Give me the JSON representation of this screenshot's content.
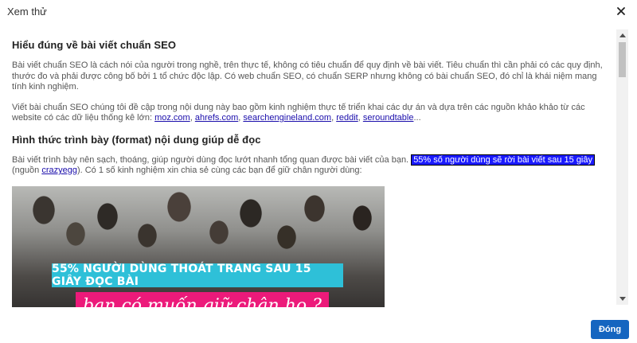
{
  "dialog": {
    "title": "Xem thử",
    "close_label": "×",
    "done_label": "Đóng"
  },
  "article": {
    "heading1": "Hiểu đúng về bài viết chuẩn SEO",
    "p1": "Bài viết chuẩn SEO là cách nói của người trong nghề, trên thực tế, không có tiêu chuẩn để quy định về bài viết. Tiêu chuẩn thì cần phải có các quy định, thước đo và phải được công bố bởi 1 tổ chức độc lập. Có web chuẩn SEO, có chuẩn SERP nhưng không có bài chuẩn SEO, đó chỉ là khái niệm mang tính kinh nghiệm.",
    "p2_text": "Viết bài chuẩn SEO chúng tôi đề cập trong nội dung này bao gồm kinh nghiệm thực tế triển khai các dự án và dựa trên các nguồn khảo khảo từ các website có các dữ liệu thống kê lớn:",
    "p2_links": [
      "moz.com",
      "ahrefs.com",
      "searchengineland.com",
      "reddit",
      "seroundtable"
    ],
    "p2_sep": ", ",
    "p2_end": "...",
    "heading2": "Hình thức trình bày (format) nội dung giúp dễ đọc",
    "p3_before": "Bài viết trình bày nên sạch, thoáng, giúp người dùng đọc lướt nhanh tổng quan được bài viết của bạn.",
    "p3_highlight": "55% số người dùng sẽ rời bài viết sau 15 giây",
    "p3_mid": " (nguồn ",
    "p3_link": "crazyegg",
    "p3_after": "). Có 1 số kinh nghiệm xin chia sẻ cùng các bạn để giữ chân người dùng:",
    "image": {
      "banner1": "55% NGƯỜI DÙNG THOÁT TRANG SAU 15 GIÂY ĐỌC BÀI",
      "banner2": "bạn có muốn giữ chân họ ?"
    }
  },
  "colors": {
    "primary_button": "#1565c0",
    "highlight": "#1a1aff",
    "banner_cyan": "#2ec0d8",
    "banner_pink": "#ec1a7a",
    "link": "#1a0dab"
  },
  "icons": {
    "close": "close-icon",
    "scroll_up": "chevron-up-icon",
    "scroll_down": "chevron-down-icon"
  }
}
